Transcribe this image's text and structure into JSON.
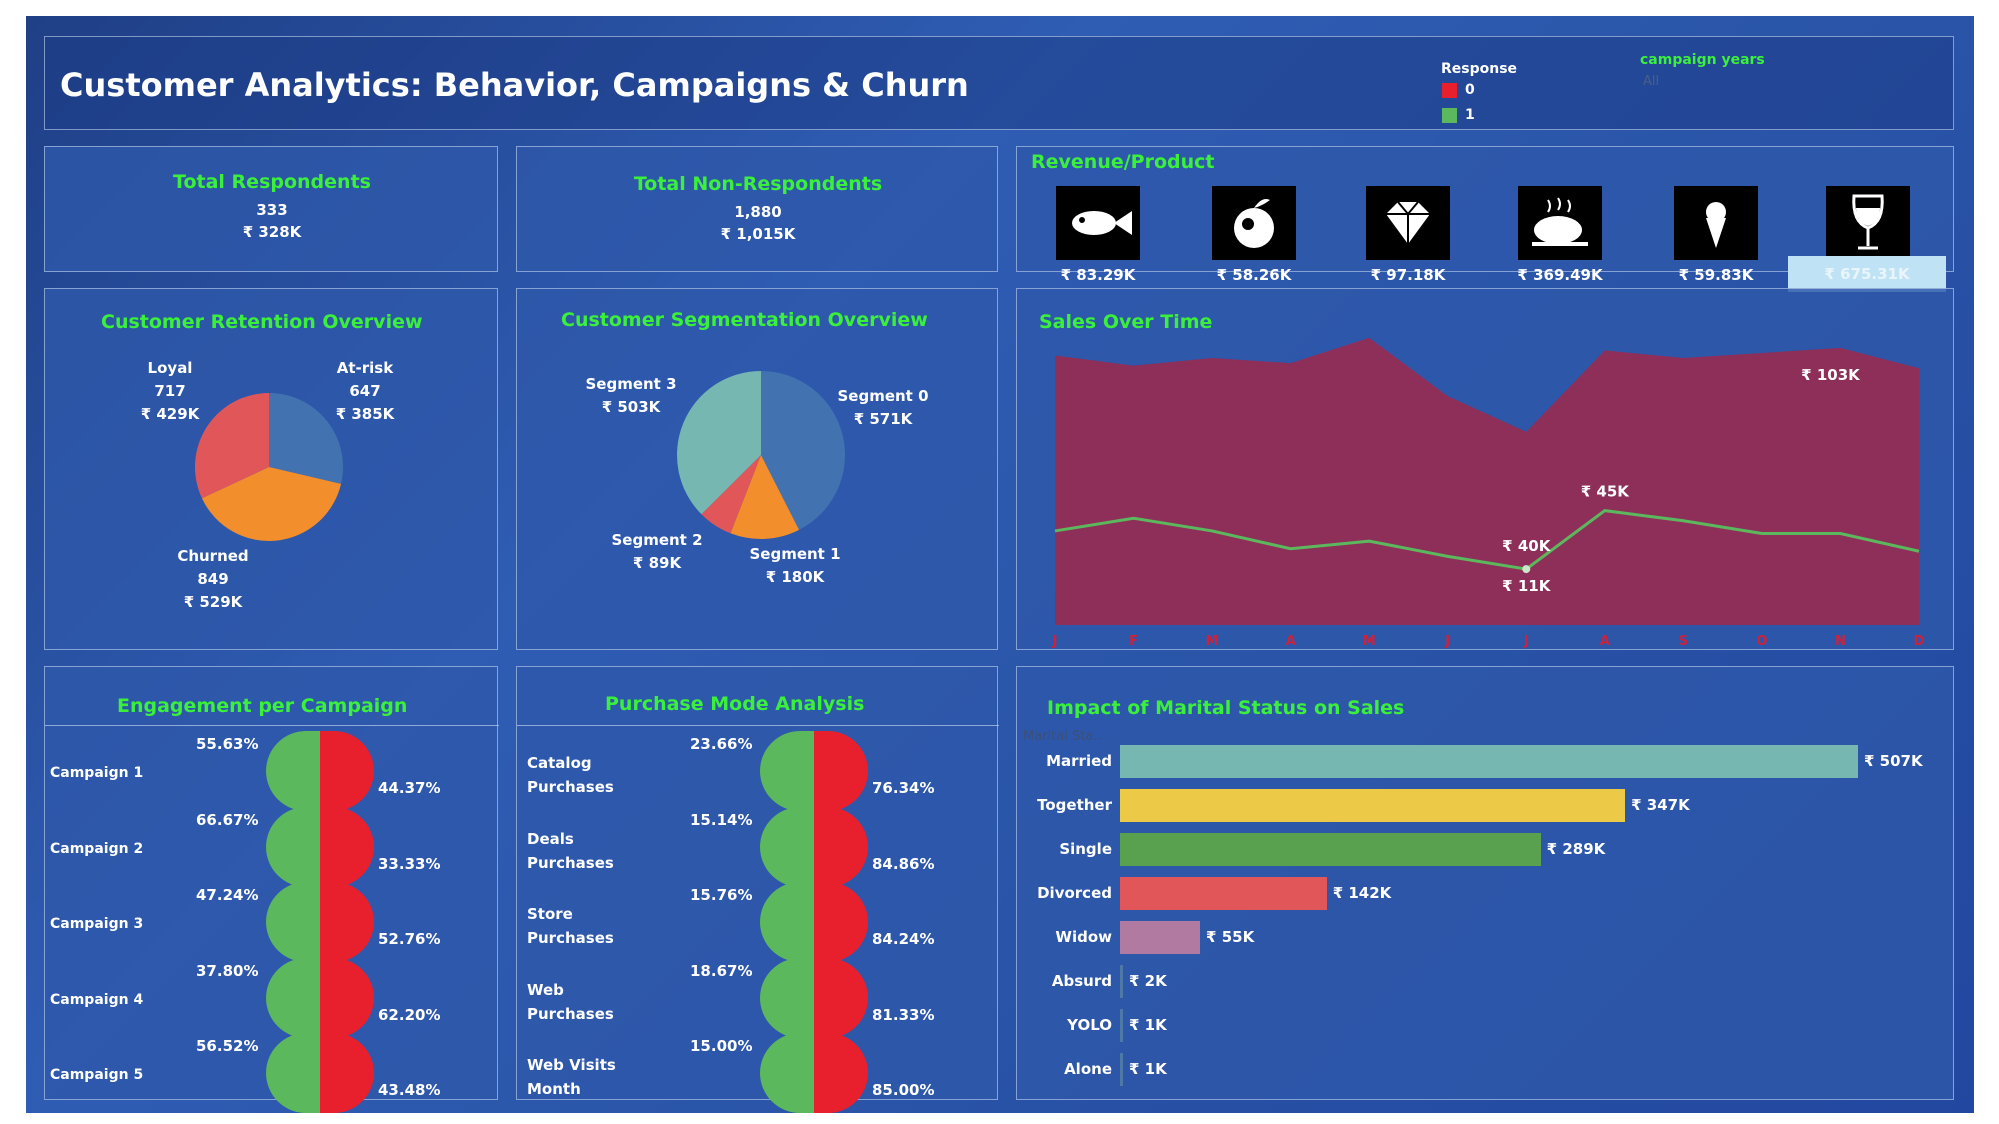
{
  "header": {
    "title": "Customer Analytics: Behavior, Campaigns & Churn",
    "response_legend": {
      "title": "Response",
      "items": [
        {
          "label": "0",
          "color": "#e8202e"
        },
        {
          "label": "1",
          "color": "#5cb85c"
        }
      ]
    },
    "campaign_filter": {
      "title": "campaign years",
      "value": "All"
    }
  },
  "kpi": {
    "respondents": {
      "title": "Total Respondents",
      "count": "333",
      "amount": "₹ 328K"
    },
    "non_respondents": {
      "title": "Total Non-Respondents",
      "count": "1,880",
      "amount": "₹ 1,015K"
    }
  },
  "revenue_per_product": {
    "title": "Revenue/Product",
    "items": [
      {
        "icon": "fish-icon",
        "value": "₹ 83.29K"
      },
      {
        "icon": "fruit-icon",
        "value": "₹ 58.26K"
      },
      {
        "icon": "diamond-icon",
        "value": "₹ 97.18K"
      },
      {
        "icon": "meat-icon",
        "value": "₹ 369.49K"
      },
      {
        "icon": "sweets-icon",
        "value": "₹ 59.83K"
      },
      {
        "icon": "wine-icon",
        "value": "₹ 675.31K"
      }
    ]
  },
  "chart_data": [
    {
      "type": "pie",
      "title": "Customer Retention Overview",
      "slices": [
        {
          "name": "At-risk",
          "count": "647",
          "amount": "₹ 385K",
          "value": 385,
          "color": "#4272b0"
        },
        {
          "name": "Churned",
          "count": "849",
          "amount": "₹ 529K",
          "value": 529,
          "color": "#f28e2b"
        },
        {
          "name": "Loyal",
          "count": "717",
          "amount": "₹ 429K",
          "value": 429,
          "color": "#e15759"
        }
      ]
    },
    {
      "type": "pie",
      "title": "Customer Segmentation Overview",
      "slices": [
        {
          "name": "Segment 0",
          "amount": "₹ 571K",
          "value": 571,
          "color": "#4272b0"
        },
        {
          "name": "Segment 1",
          "amount": "₹ 180K",
          "value": 180,
          "color": "#f28e2b"
        },
        {
          "name": "Segment 2",
          "amount": "₹ 89K",
          "value": 89,
          "color": "#e15759"
        },
        {
          "name": "Segment 3",
          "amount": "₹ 503K",
          "value": 503,
          "color": "#76b7b2"
        }
      ]
    },
    {
      "type": "area",
      "title": "Sales Over Time",
      "categories": [
        "J",
        "F",
        "M",
        "A",
        "M",
        "J",
        "J",
        "A",
        "S",
        "O",
        "N",
        "D"
      ],
      "series": [
        {
          "response": "0",
          "color": "#8e2f5a",
          "values": [
            106,
            102,
            105,
            103,
            113,
            90,
            76,
            108,
            105,
            107,
            109,
            101
          ]
        },
        {
          "response": "1",
          "color": "#5cb85c",
          "values": [
            37,
            42,
            37,
            30,
            33,
            27,
            22,
            45,
            41,
            36,
            36,
            29
          ]
        }
      ],
      "ylim": [
        0,
        118
      ],
      "annotations": [
        {
          "label": "₹ 103K",
          "x": "N"
        },
        {
          "label": "₹ 45K",
          "x": "A"
        },
        {
          "label": "₹ 40K",
          "x": "J"
        },
        {
          "label": "₹ 11K",
          "x": "J"
        }
      ]
    },
    {
      "type": "bar",
      "title": "Engagement per Campaign",
      "categories": [
        "Campaign 1",
        "Campaign 2",
        "Campaign 3",
        "Campaign 4",
        "Campaign 5"
      ],
      "series": [
        {
          "response": "1",
          "color": "#5cb85c",
          "values": [
            55.63,
            66.67,
            47.24,
            37.8,
            56.52
          ],
          "labels": [
            "55.63%",
            "66.67%",
            "47.24%",
            "37.80%",
            "56.52%"
          ]
        },
        {
          "response": "0",
          "color": "#e8202e",
          "values": [
            44.37,
            33.33,
            52.76,
            62.2,
            43.48
          ],
          "labels": [
            "44.37%",
            "33.33%",
            "52.76%",
            "62.20%",
            "43.48%"
          ]
        }
      ]
    },
    {
      "type": "bar",
      "title": "Purchase Mode Analysis",
      "categories": [
        "Catalog Purchases",
        "Deals Purchases",
        "Store Purchases",
        "Web Purchases",
        "Web Visits Month"
      ],
      "category_lines": [
        [
          "Catalog",
          "Purchases"
        ],
        [
          "Deals",
          "Purchases"
        ],
        [
          "Store",
          "Purchases"
        ],
        [
          "Web",
          "Purchases"
        ],
        [
          "Web Visits",
          "Month"
        ]
      ],
      "series": [
        {
          "response": "1",
          "color": "#5cb85c",
          "values": [
            23.66,
            15.14,
            15.76,
            18.67,
            15.0
          ],
          "labels": [
            "23.66%",
            "15.14%",
            "15.76%",
            "18.67%",
            "15.00%"
          ]
        },
        {
          "response": "0",
          "color": "#e8202e",
          "values": [
            76.34,
            84.86,
            84.24,
            81.33,
            85.0
          ],
          "labels": [
            "76.34%",
            "84.86%",
            "84.24%",
            "81.33%",
            "85.00%"
          ]
        }
      ]
    },
    {
      "type": "bar",
      "title": "Impact of Marital Status on Sales",
      "axis_header": "Marital Sta..",
      "categories": [
        "Married",
        "Together",
        "Single",
        "Divorced",
        "Widow",
        "Absurd",
        "YOLO",
        "Alone"
      ],
      "values": [
        507,
        347,
        289,
        142,
        55,
        2,
        1,
        1
      ],
      "labels": [
        "₹ 507K",
        "₹ 347K",
        "₹ 289K",
        "₹ 142K",
        "₹ 55K",
        "₹ 2K",
        "₹ 1K",
        "₹ 1K"
      ],
      "colors": [
        "#76b7b2",
        "#edc948",
        "#59a14f",
        "#e15759",
        "#b07aa1",
        "#4e79a7",
        "#4e79a7",
        "#4e79a7"
      ]
    }
  ]
}
